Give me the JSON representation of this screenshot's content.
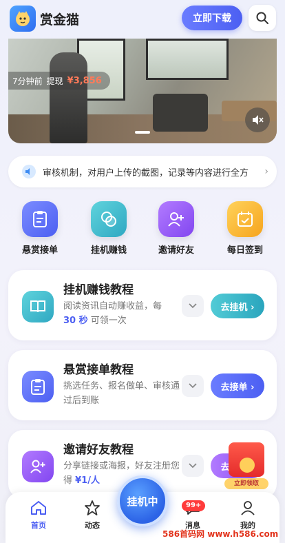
{
  "header": {
    "app_name": "赏金猫",
    "download_label": "立即下载",
    "search_icon": "search-icon"
  },
  "banner": {
    "ticker_time": "7分钟前",
    "ticker_action": "提现",
    "ticker_amount": "¥3,856",
    "mute_icon": "speaker-mute-icon"
  },
  "notice": {
    "text": "审核机制，对用户上传的截图，记录等内容进行全方",
    "icon": "speaker-icon"
  },
  "quick_actions": [
    {
      "label": "悬赏接单",
      "icon": "clipboard-icon",
      "color": "#5a6ff0"
    },
    {
      "label": "挂机赚钱",
      "icon": "coins-icon",
      "color": "#34b6c9"
    },
    {
      "label": "邀请好友",
      "icon": "add-user-icon",
      "color": "#9a5cf0"
    },
    {
      "label": "每日签到",
      "icon": "calendar-check-icon",
      "color": "#f7b52c"
    }
  ],
  "cards": [
    {
      "title": "挂机赚钱教程",
      "desc_prefix": "阅读资讯自动赚收益，每",
      "desc_highlight": "30 秒",
      "desc_suffix": " 可领一次",
      "action": "去挂机 ›",
      "icon": "book-icon",
      "color": "#34b6c9"
    },
    {
      "title": "悬赏接单教程",
      "desc": "挑选任务、报名做单、审核通过后到账",
      "action": "去接单 ›",
      "icon": "clipboard-icon",
      "color": "#5a6ff0"
    },
    {
      "title": "邀请好友教程",
      "desc_prefix": "分享链接或海报，好友注册您得 ",
      "desc_highlight": "¥1/人",
      "action": "去邀请 ›",
      "icon": "add-user-icon",
      "color": "#9a5cf0"
    }
  ],
  "red_packet": {
    "label": "立即领取"
  },
  "tabbar": {
    "tabs": [
      {
        "label": "首页",
        "icon": "home-icon"
      },
      {
        "label": "动态",
        "icon": "star-icon"
      },
      {
        "label": "消息",
        "icon": "message-icon"
      },
      {
        "label": "我的",
        "icon": "user-icon"
      }
    ],
    "fab_label": "挂机中",
    "badge": "99+"
  },
  "watermark": "586首码网 www.h586.com"
}
